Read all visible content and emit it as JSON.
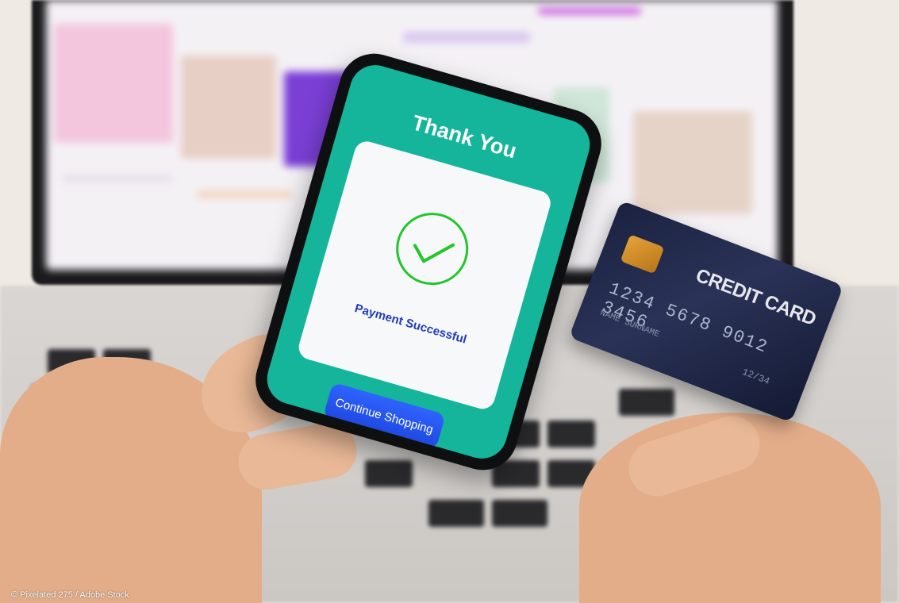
{
  "phone": {
    "title": "Thank You",
    "status_message": "Payment Successful",
    "continue_button": "Continue Shopping",
    "accent_color": "#14b59a",
    "check_color": "#22c62a"
  },
  "credit_card": {
    "title": "CREDIT CARD",
    "number": "1234 5678 9012 3456",
    "holder_name": "NAME SURNAME",
    "expiry": "12/34"
  },
  "watermark": "© Pixelated 275 / Adobe Stock"
}
